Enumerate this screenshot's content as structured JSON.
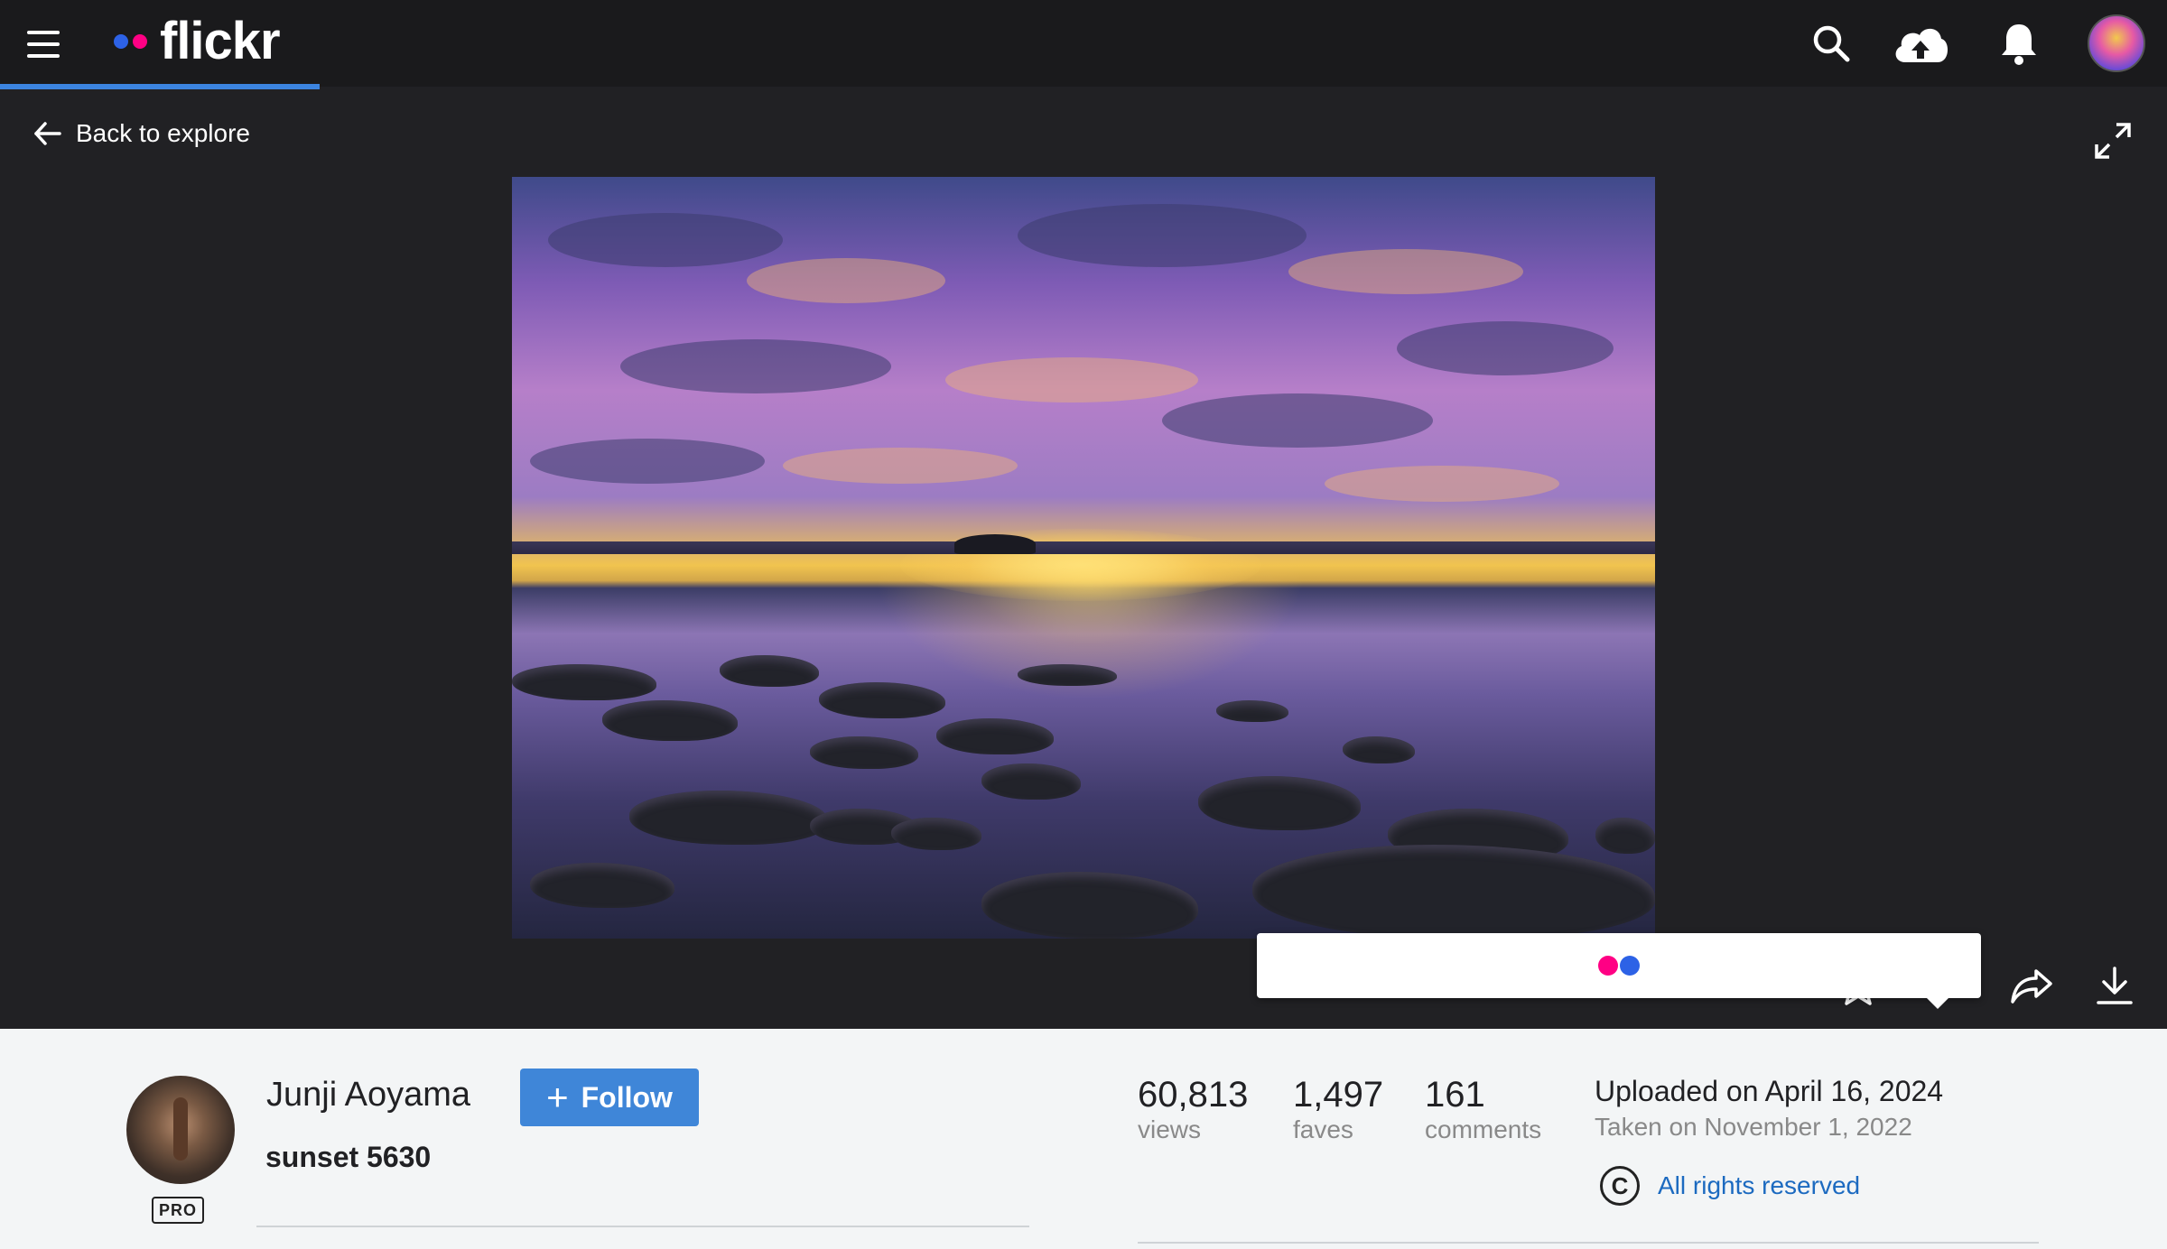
{
  "header": {
    "brand": "flickr"
  },
  "nav": {
    "back_label": "Back to explore"
  },
  "photo": {
    "title": "sunset 5630",
    "uploaded": "Uploaded on April 16, 2024",
    "taken": "Taken on November 1, 2022",
    "license": "All rights reserved",
    "license_symbol": "C"
  },
  "owner": {
    "name": "Junji Aoyama",
    "pro_label": "PRO",
    "follow_label": "Follow",
    "follow_symbol": "+"
  },
  "stats": [
    {
      "num": "60,813",
      "label": "views"
    },
    {
      "num": "1,497",
      "label": "faves"
    },
    {
      "num": "161",
      "label": "comments"
    }
  ],
  "colors": {
    "topbar": "#1a1a1c",
    "background": "#212124",
    "accent_blue": "#3f86d8",
    "link_blue": "#1c6ac0",
    "flickr_pink": "#ff0084",
    "flickr_blue": "#2d62e6",
    "info_panel": "#f3f5f6"
  },
  "icons": {
    "menu": "hamburger-menu-icon",
    "search": "search-icon",
    "upload": "cloud-upload-icon",
    "notifications": "bell-icon",
    "back": "arrow-left-icon",
    "expand": "expand-icon",
    "favorite": "star-icon",
    "comment": "comment-icon",
    "share": "share-arrow-icon",
    "download": "download-icon",
    "license": "copyright-icon"
  }
}
